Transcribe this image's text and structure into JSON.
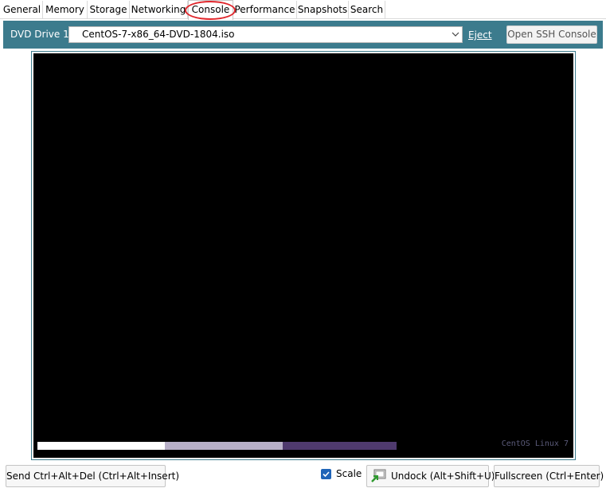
{
  "tabs": [
    {
      "label": "General"
    },
    {
      "label": "Memory"
    },
    {
      "label": "Storage"
    },
    {
      "label": "Networking"
    },
    {
      "label": "Console"
    },
    {
      "label": "Performance"
    },
    {
      "label": "Snapshots"
    },
    {
      "label": "Search"
    }
  ],
  "active_tab": "Console",
  "dvd": {
    "label": "DVD Drive 1:",
    "selected": "CentOS-7-x86_64-DVD-1804.iso",
    "eject_label": "Eject",
    "ssh_button_label": "Open SSH Console"
  },
  "console": {
    "os_label": "CentOS Linux 7"
  },
  "bottom": {
    "send_cad_label": "Send Ctrl+Alt+Del (Ctrl+Alt+Insert)",
    "scale_label": "Scale",
    "scale_checked": true,
    "undock_label": "Undock (Alt+Shift+U)",
    "fullscreen_label": "Fullscreen (Ctrl+Enter)"
  },
  "colors": {
    "header_bar": "#3c7b8d",
    "highlight": "#e0262b",
    "progress_white": "#ffffff",
    "progress_light": "#b8b0c8",
    "progress_purple": "#4f3a6e"
  },
  "icons": [
    "chevron-down-icon",
    "checkbox-checked-icon",
    "undock-icon"
  ]
}
